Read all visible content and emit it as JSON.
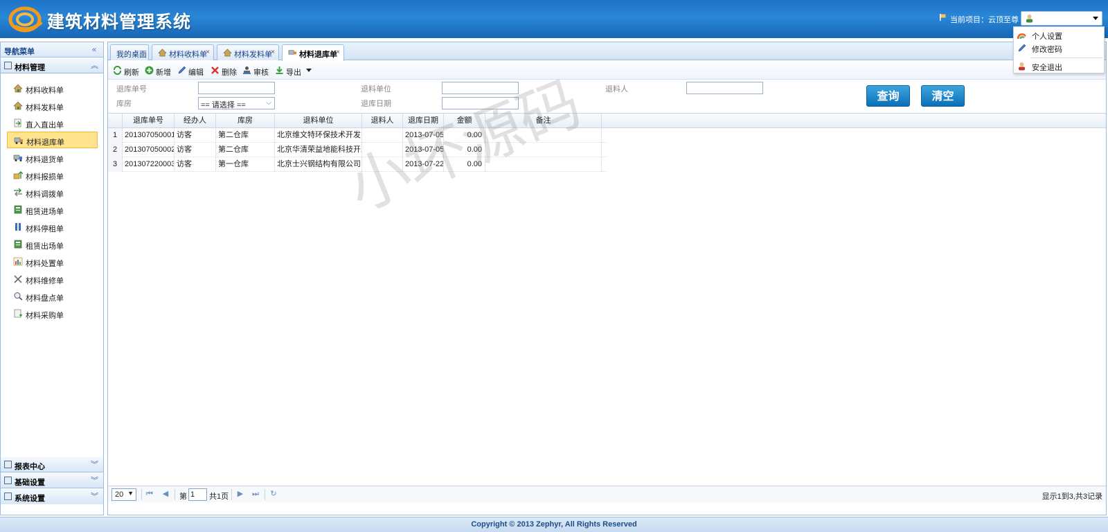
{
  "header": {
    "app_title": "建筑材料管理系统",
    "project_label": "当前项目：云顶至尊",
    "user_menu": [
      "个人设置",
      "修改密码",
      "安全退出"
    ]
  },
  "sidebar": {
    "title": "导航菜单",
    "section_open": "材料管理",
    "items": [
      "材料收料单",
      "材料发料单",
      "直入直出单",
      "材料退库单",
      "材料退货单",
      "材料报损单",
      "材料调拨单",
      "租赁进场单",
      "材料停租单",
      "租赁出场单",
      "材料处置单",
      "材料维修单",
      "材料盘点单",
      "材料采购单"
    ],
    "active_item": "材料退库单",
    "sections_closed": [
      "报表中心",
      "基础设置",
      "系统设置"
    ]
  },
  "tabs": {
    "desktop": "我的桌面",
    "items": [
      "材料收料单",
      "材料发料单",
      "材料退库单"
    ],
    "active": "材料退库单"
  },
  "toolbar": [
    "刷新",
    "新增",
    "编辑",
    "删除",
    "审核",
    "导出"
  ],
  "filters": {
    "return_no_label": "退库单号",
    "dept_label": "退料单位",
    "person_label": "退料人",
    "warehouse_label": "库房",
    "warehouse_value": "== 请选择 ==",
    "date_label": "退库日期",
    "query_button": "查询",
    "clear_button": "清空"
  },
  "grid": {
    "columns": [
      "退库单号",
      "经办人",
      "库房",
      "退料单位",
      "退料人",
      "退库日期",
      "金额",
      "备注"
    ],
    "rows": [
      {
        "num": "1",
        "no": "201307050001",
        "handler": "访客",
        "warehouse": "第二仓库",
        "unit": "北京维文特环保技术开发有限",
        "person": "",
        "date": "2013-07-05",
        "amount": "0.00",
        "note": ""
      },
      {
        "num": "2",
        "no": "201307050002",
        "handler": "访客",
        "warehouse": "第二仓库",
        "unit": "北京华清荣益地能科技开发有",
        "person": "",
        "date": "2013-07-05",
        "amount": "0.00",
        "note": ""
      },
      {
        "num": "3",
        "no": "201307220003",
        "handler": "访客",
        "warehouse": "第一仓库",
        "unit": "北京士兴钢结构有限公司",
        "person": "",
        "date": "2013-07-22",
        "amount": "0.00",
        "note": ""
      }
    ]
  },
  "watermark": "小坏源码",
  "pager": {
    "page_size": "20",
    "page_prefix": "第",
    "page_value": "1",
    "page_total": "共1页",
    "info": "显示1到3,共3记录"
  },
  "footer": "Copyright © 2013 Zephyr, All Rights Reserved",
  "colors": {
    "header": "#1e73c6",
    "accent_button": "#0b6fb6",
    "active_nav": "#ffe48d"
  }
}
